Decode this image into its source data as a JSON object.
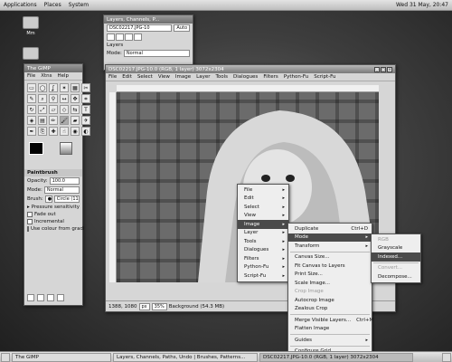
{
  "top_panel": {
    "menus": [
      "Applications",
      "Places",
      "System"
    ],
    "clock": "Wed 31 May, 20:47"
  },
  "desktop": {
    "icon1": "Mm"
  },
  "toolbox": {
    "title": "The GIMP",
    "menu": [
      "File",
      "Xtns",
      "Help"
    ],
    "options_title": "Paintbrush",
    "opacity_label": "Opacity:",
    "opacity_value": "100.0",
    "mode_label": "Mode:",
    "mode_value": "Normal",
    "brush_label": "Brush:",
    "brush_value": "Circle (11)",
    "pressure": "Pressure sensitivity",
    "fade": "Fade out",
    "incremental": "Incremental",
    "use_colour": "Use colour from gradi"
  },
  "layers": {
    "title": "Layers, Channels, P...",
    "image_select": "DSC02217.JPG-10",
    "auto": "Auto",
    "heading": "Layers",
    "mode_label": "Mode:",
    "mode_value": "Normal"
  },
  "image_window": {
    "title": "DSC02217.JPG-10.0 (RGB, 1 layer) 3072x2304",
    "menu": [
      "File",
      "Edit",
      "Select",
      "View",
      "Image",
      "Layer",
      "Tools",
      "Dialogues",
      "Filters",
      "Python-Fu",
      "Script-Fu"
    ],
    "coords": "1388, 1080",
    "unit": "px",
    "zoom": "35%",
    "status": "Background (54.3 MB)"
  },
  "context_menu": [
    "File",
    "Edit",
    "Select",
    "View",
    "Image",
    "Layer",
    "Tools",
    "Dialogues",
    "Filters",
    "Python-Fu",
    "Script-Fu"
  ],
  "image_submenu": [
    {
      "label": "Duplicate",
      "shortcut": "Ctrl+D"
    },
    {
      "label": "Mode",
      "arrow": true,
      "hl": true
    },
    {
      "label": "Transform",
      "arrow": true
    },
    {
      "sep": true
    },
    {
      "label": "Canvas Size..."
    },
    {
      "label": "Fit Canvas to Layers"
    },
    {
      "label": "Print Size..."
    },
    {
      "label": "Scale Image..."
    },
    {
      "label": "Crop Image",
      "dis": true
    },
    {
      "label": "Autocrop Image"
    },
    {
      "label": "Zealous Crop"
    },
    {
      "sep": true
    },
    {
      "label": "Merge Visible Layers...",
      "shortcut": "Ctrl+M"
    },
    {
      "label": "Flatten Image"
    },
    {
      "sep": true
    },
    {
      "label": "Guides",
      "arrow": true
    },
    {
      "sep": true
    },
    {
      "label": "Configure Grid..."
    }
  ],
  "mode_submenu": [
    {
      "label": "RGB",
      "dis": true
    },
    {
      "label": "Grayscale"
    },
    {
      "label": "Indexed...",
      "hl": true
    },
    {
      "sep": true
    },
    {
      "label": "Convert...",
      "dis": true
    },
    {
      "label": "Decompose..."
    }
  ],
  "taskbar": [
    "The GIMP",
    "Layers, Channels, Paths, Undo | Brushes, Patterns...",
    "DSC02217.JPG-10.0 (RGB, 1 layer) 3072x2304"
  ]
}
